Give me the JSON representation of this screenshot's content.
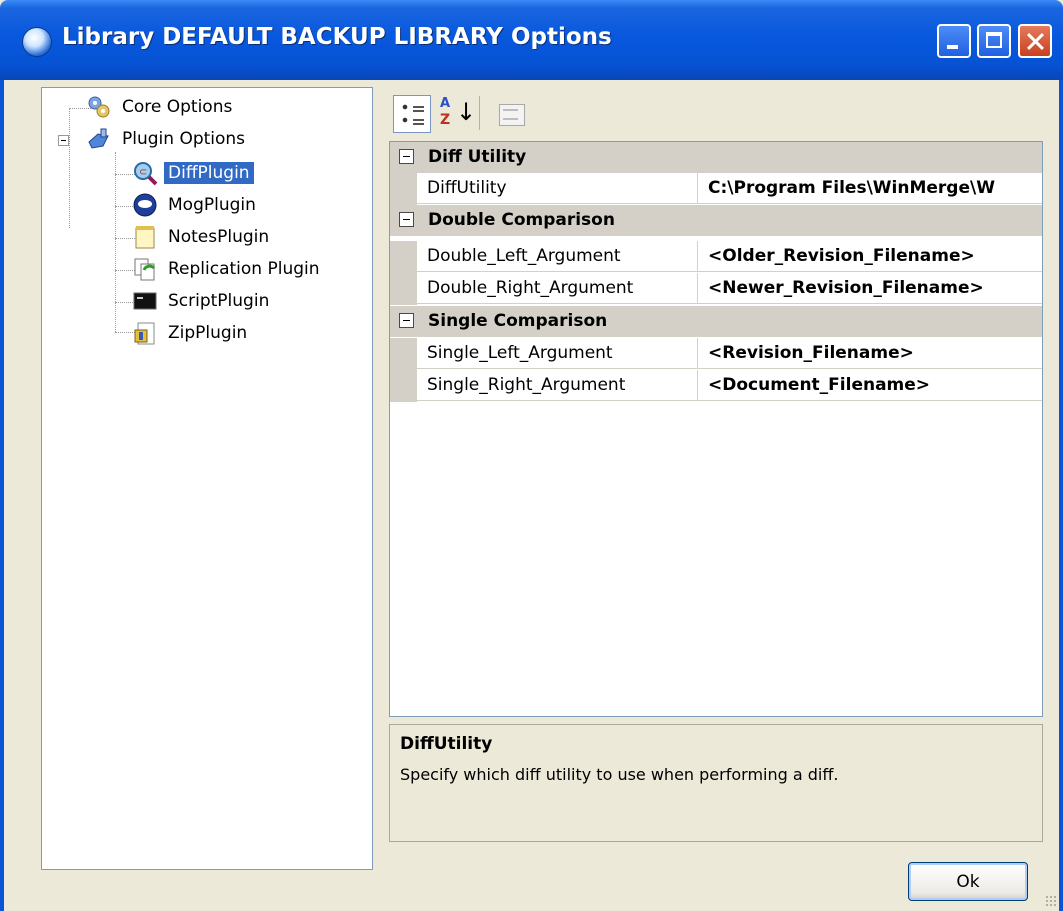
{
  "window": {
    "title": "Library DEFAULT BACKUP LIBRARY Options"
  },
  "tree": {
    "items": [
      {
        "label": "Core Options",
        "icon": "core-options-icon"
      },
      {
        "label": "Plugin Options",
        "icon": "plugin-options-icon"
      },
      {
        "label": "DiffPlugin",
        "icon": "diff-plugin-icon",
        "selected": true
      },
      {
        "label": "MogPlugin",
        "icon": "mog-plugin-icon"
      },
      {
        "label": "NotesPlugin",
        "icon": "notes-plugin-icon"
      },
      {
        "label": "Replication Plugin",
        "icon": "replication-plugin-icon"
      },
      {
        "label": "ScriptPlugin",
        "icon": "script-plugin-icon"
      },
      {
        "label": "ZipPlugin",
        "icon": "zip-plugin-icon"
      }
    ]
  },
  "toolbar": {
    "categorized_icon": "categorized-view-icon",
    "alphabetical_icon": "sort-alphabetical-icon",
    "property_pages_icon": "property-pages-icon",
    "az_top": "A",
    "az_bottom": "Z",
    "az_arrow": "↓"
  },
  "grid": {
    "categories": [
      {
        "label": "Diff Utility",
        "properties": [
          {
            "name": "DiffUtility",
            "value": "C:\\Program Files\\WinMerge\\W"
          }
        ]
      },
      {
        "label": "Double Comparison",
        "properties": [
          {
            "name": "Double_Left_Argument",
            "value": "<Older_Revision_Filename>"
          },
          {
            "name": "Double_Right_Argument",
            "value": "<Newer_Revision_Filename>"
          }
        ]
      },
      {
        "label": "Single Comparison",
        "properties": [
          {
            "name": "Single_Left_Argument",
            "value": "<Revision_Filename>"
          },
          {
            "name": "Single_Right_Argument",
            "value": "<Document_Filename>"
          }
        ]
      }
    ]
  },
  "help": {
    "title": "DiffUtility",
    "description": "Specify which diff utility to use when performing a diff."
  },
  "buttons": {
    "ok_label": "Ok"
  },
  "colors": {
    "titlebar": "#0858de",
    "selection": "#316ac5",
    "dialog_bg": "#ece9d8",
    "category_bg": "#d4d0c8"
  }
}
